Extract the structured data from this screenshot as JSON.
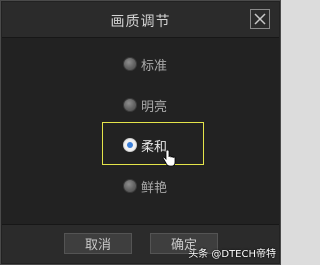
{
  "dialog": {
    "title": "画质调节",
    "close_icon": "close-icon"
  },
  "options": [
    {
      "label": "标准",
      "selected": false
    },
    {
      "label": "明亮",
      "selected": false
    },
    {
      "label": "柔和",
      "selected": true
    },
    {
      "label": "鲜艳",
      "selected": false
    }
  ],
  "buttons": {
    "cancel": "取消",
    "confirm": "确定"
  },
  "watermark": "头条 @DTECH帝特",
  "colors": {
    "background": "#222222",
    "highlight": "#e4e44a",
    "radio_selected": "#3b7fd9"
  }
}
